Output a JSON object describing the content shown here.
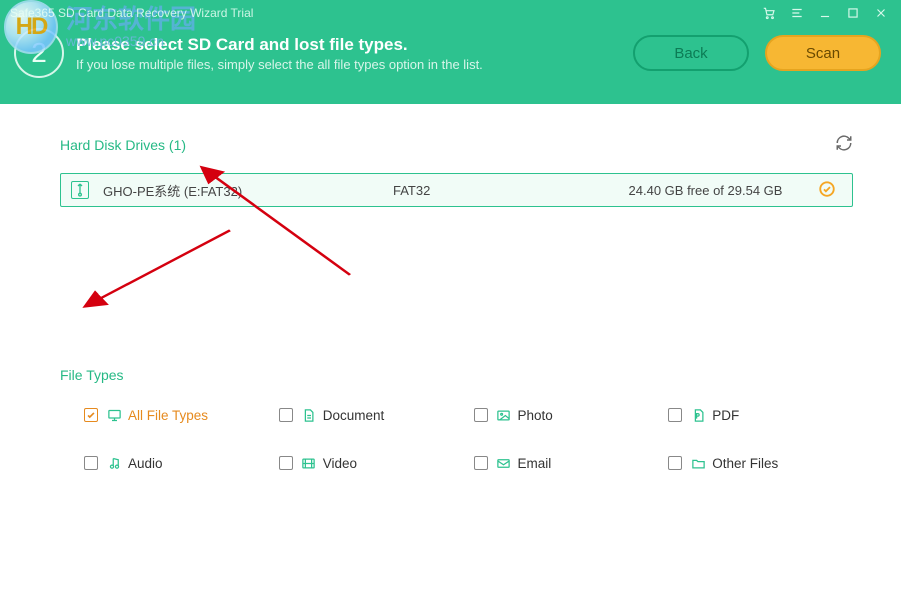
{
  "window": {
    "title": "Safe365 SD Card Data Recovery Wizard Trial"
  },
  "watermark": {
    "logo_text": "HD",
    "cn": "河东软件园",
    "url": "www.pc0359.cn"
  },
  "step": {
    "number": "2",
    "headline": "Please select SD Card and lost file types.",
    "sub": "If you lose multiple files, simply select the all file types option in the list."
  },
  "buttons": {
    "back": "Back",
    "scan": "Scan"
  },
  "drives": {
    "section": "Hard Disk Drives (1)",
    "items": [
      {
        "name": "GHO-PE系统 (E:FAT32)",
        "fs": "FAT32",
        "free": "24.40 GB free of 29.54 GB",
        "selected": true
      }
    ]
  },
  "file_types": {
    "section": "File Types",
    "items": [
      {
        "label": "All File Types",
        "checked": true,
        "icon": "monitor"
      },
      {
        "label": "Document",
        "checked": false,
        "icon": "doc"
      },
      {
        "label": "Photo",
        "checked": false,
        "icon": "image"
      },
      {
        "label": "PDF",
        "checked": false,
        "icon": "pdf"
      },
      {
        "label": "Audio",
        "checked": false,
        "icon": "audio"
      },
      {
        "label": "Video",
        "checked": false,
        "icon": "video"
      },
      {
        "label": "Email",
        "checked": false,
        "icon": "mail"
      },
      {
        "label": "Other Files",
        "checked": false,
        "icon": "folder"
      }
    ]
  }
}
